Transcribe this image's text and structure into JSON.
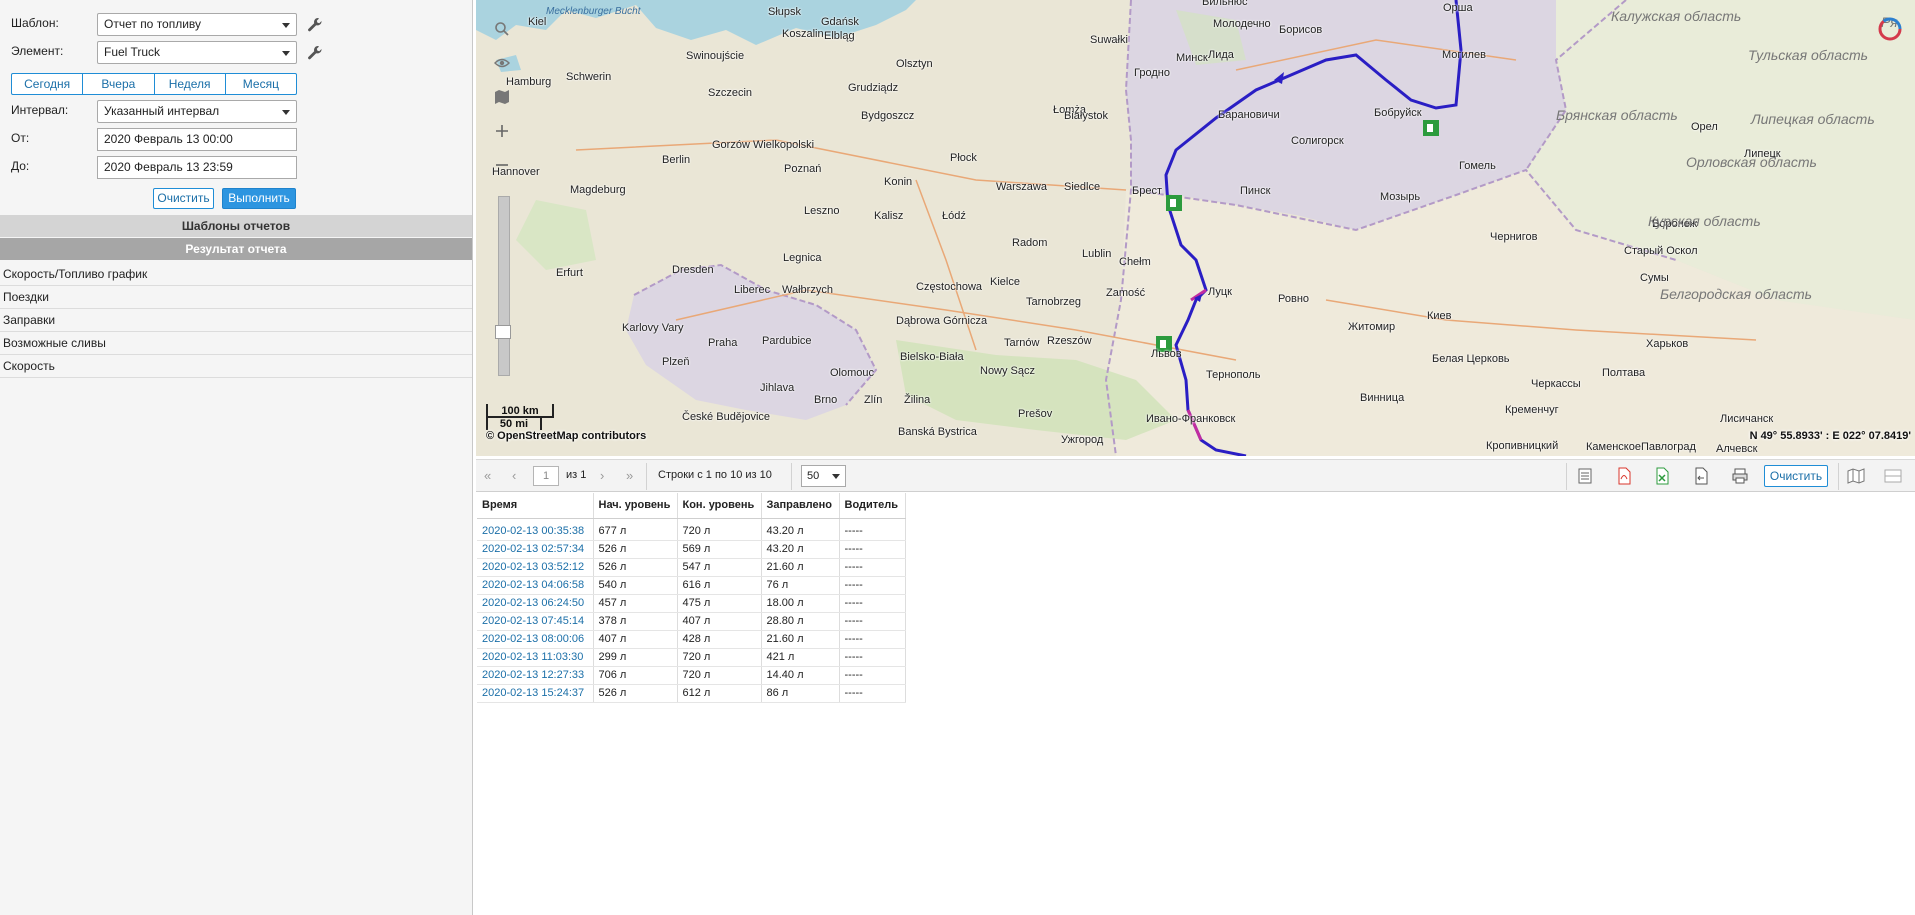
{
  "form": {
    "template_label": "Шаблон:",
    "template_value": "Отчет по топливу",
    "element_label": "Элемент:",
    "element_value": "Fuel Truck",
    "periods": [
      "Сегодня",
      "Вчера",
      "Неделя",
      "Месяц"
    ],
    "interval_label": "Интервал:",
    "interval_value": "Указанный интервал",
    "from_label": "От:",
    "from_value": "2020 Февраль 13 00:00",
    "to_label": "До:",
    "to_value": "2020 Февраль 13 23:59",
    "clear_label": "Очистить",
    "run_label": "Выполнить"
  },
  "sections": {
    "templates": "Шаблоны отчетов",
    "result": "Результат отчета"
  },
  "result_items": [
    "Скорость/Топливо график",
    "Поездки",
    "Заправки",
    "Возможные сливы",
    "Скорость"
  ],
  "map": {
    "scale_km": "100 km",
    "scale_mi": "50 mi",
    "attribution": "© OpenStreetMap contributors",
    "coords": "N 49° 55.8933' : E 022° 07.8419'",
    "sea_label": "Mecklenburger Bucht",
    "cities": [
      "Kiel",
      "Słupsk",
      "Gdańsk",
      "Koszalin",
      "Elbląg",
      "Suwałki",
      "Olsztyn",
      "Swinoujście",
      "Schwerin",
      "Hamburg",
      "Szczecin",
      "Grudziądz",
      "Bydgoszcz",
      "Gorzów Wielkopolski",
      "Berlin",
      "Łomża",
      "Białystok",
      "Płock",
      "Poznań",
      "Warszawa",
      "Siedlce",
      "Magdeburg",
      "Hannover",
      "Leszno",
      "Konin",
      "Kalisz",
      "Łódź",
      "Radom",
      "Lublin",
      "Chełm",
      "Zamość",
      "Legnica",
      "Dresden",
      "Erfurt",
      "Liberec",
      "Wałbrzych",
      "Częstochowa",
      "Kielce",
      "Tarnobrzeg",
      "Karlovy Vary",
      "Praha",
      "Pardubice",
      "Dąbrowa Górnicza",
      "Bielsko-Biała",
      "Tarnów",
      "Rzeszów",
      "Plzeň",
      "Olomouc",
      "Jihlava",
      "Brno",
      "Zlín",
      "Žilina",
      "Nowy Sącz",
      "České Budějovice",
      "Banská Bystrica",
      "Prešov",
      "Ужгород",
      "Вильнюс",
      "Минск",
      "Молодечно",
      "Борисов",
      "Лида",
      "Гродно",
      "Барановичи",
      "Бобруйск",
      "Солигорск",
      "Брест",
      "Пинск",
      "Мозырь",
      "Гомель",
      "Орша",
      "Могилев",
      "Луцк",
      "Ровно",
      "Львов",
      "Тернополь",
      "Ивано-Франковск",
      "Житомир",
      "Киев",
      "Белая Церковь",
      "Винница",
      "Черкассы",
      "Кременчуг",
      "Полтава",
      "Харьков",
      "Сумы",
      "Чернигов",
      "Старый Оскол",
      "Воронеж",
      "Орел",
      "Липецк",
      "Кропивницкий",
      "КаменскоеПавлоград",
      "Лисичанск",
      "Алчевск"
    ],
    "oblasts": [
      "Калужская область",
      "Тульская область",
      "Брянская область",
      "Липецкая область",
      "Орловская область",
      "Курская область",
      "Белгородская область",
      "Ря"
    ]
  },
  "toolbar": {
    "page": "1",
    "of": "из 1",
    "rows_info": "Строки с 1 по 10 из 10",
    "per_page": "50",
    "clear_label": "Очистить"
  },
  "table": {
    "headers": [
      "Время",
      "Нач. уровень",
      "Кон. уровень",
      "Заправлено",
      "Водитель"
    ],
    "rows": [
      [
        "2020-02-13 00:35:38",
        "677 л",
        "720 л",
        "43.20 л",
        "-----"
      ],
      [
        "2020-02-13 02:57:34",
        "526 л",
        "569 л",
        "43.20 л",
        "-----"
      ],
      [
        "2020-02-13 03:52:12",
        "526 л",
        "547 л",
        "21.60 л",
        "-----"
      ],
      [
        "2020-02-13 04:06:58",
        "540 л",
        "616 л",
        "76 л",
        "-----"
      ],
      [
        "2020-02-13 06:24:50",
        "457 л",
        "475 л",
        "18.00 л",
        "-----"
      ],
      [
        "2020-02-13 07:45:14",
        "378 л",
        "407 л",
        "28.80 л",
        "-----"
      ],
      [
        "2020-02-13 08:00:06",
        "407 л",
        "428 л",
        "21.60 л",
        "-----"
      ],
      [
        "2020-02-13 11:03:30",
        "299 л",
        "720 л",
        "421 л",
        "-----"
      ],
      [
        "2020-02-13 12:27:33",
        "706 л",
        "720 л",
        "14.40 л",
        "-----"
      ],
      [
        "2020-02-13 15:24:37",
        "526 л",
        "612 л",
        "86 л",
        "-----"
      ]
    ]
  }
}
